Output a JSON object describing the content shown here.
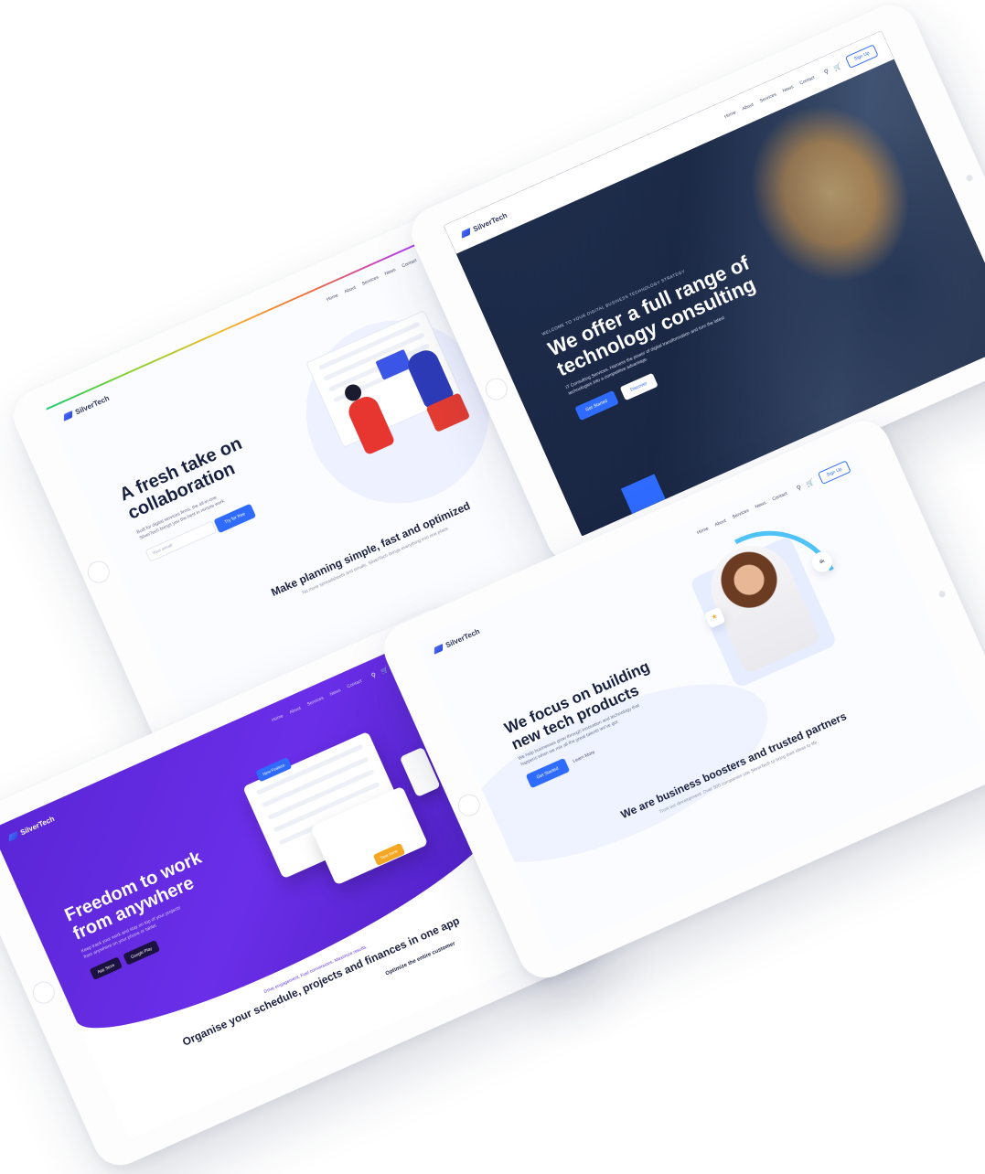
{
  "colors": {
    "primary": "#2f6bff",
    "purple": "#5a26d6",
    "dark_navy": "#17203f"
  },
  "brand": "SilverTech",
  "nav": {
    "menu": [
      "Home",
      "About",
      "Services",
      "News",
      "Contact"
    ],
    "signup": "Sign Up"
  },
  "tablet_collab": {
    "hero_title": "A fresh take on collaboration",
    "hero_text": "Built for digital services firms, the all-in-one SilverTech brings you the best in remote work.",
    "email_placeholder": "Your email",
    "cta": "Try for free",
    "section_title": "Make planning simple, fast and optimized",
    "section_sub": "No more spreadsheets and emails. SilverTech brings everything into one place."
  },
  "tablet_consulting": {
    "kicker": "WELCOME TO YOUR DIGITAL BUSINESS TECHNOLOGY STRATEGY",
    "hero_title": "We offer a full range of technology consulting",
    "hero_text": "IT Consulting Services. Harness the power of digital transformation and turn the latest technologies into a competitive advantage.",
    "btn_primary": "Get Started",
    "btn_secondary": "Discover"
  },
  "tablet_remote": {
    "hero_title": "Freedom to work from anywhere",
    "hero_text": "Keep track your work and stay on top of your projects from anywhere on your phone or tablet.",
    "store_apple": "App Store",
    "store_google": "Google Play",
    "chip1": "New Feature",
    "chip2": "Task done",
    "kicker": "Drive engagement. Fuel conversions. Maximize results.",
    "section_title": "Organise your schedule, projects and finances in one app",
    "section2": "Optimize the entire customer"
  },
  "tablet_products": {
    "hero_title": "We focus on building new tech products",
    "hero_text": "We help businesses grow through innovation and technology that happens when we mix all the great talents we've got.",
    "btn_primary": "Get Started",
    "btn_secondary": "Learn More",
    "stat": "8k",
    "section_title": "We are business boosters and trusted partners",
    "section_sub": "Trust our development. Over 500 companies use SilverTech to bring their ideas to life."
  }
}
